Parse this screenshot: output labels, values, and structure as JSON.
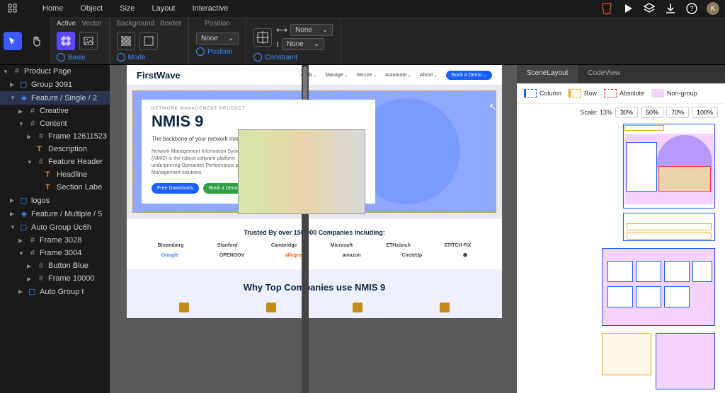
{
  "menu": {
    "items": [
      "Home",
      "Object",
      "Size",
      "Layout",
      "Interactive"
    ],
    "avatar_letter": "K"
  },
  "toolbar": {
    "group1": {
      "head": [
        "Active",
        "Vector"
      ],
      "foot": "Basic"
    },
    "group2": {
      "head": [
        "Background",
        "Border"
      ],
      "foot": "Mode"
    },
    "group3": {
      "head": "Position",
      "value": "None",
      "foot": "Position"
    },
    "group4": {
      "head": "",
      "val1": "None",
      "val2": "None",
      "foot": "Constraint"
    }
  },
  "layers": {
    "root": "Product Page",
    "items": [
      {
        "ind": 1,
        "chev": "▶",
        "ico": "frame",
        "label": "Group 3091"
      },
      {
        "ind": 1,
        "chev": "▼",
        "ico": "hashb",
        "label": "Feature / Single / 2",
        "sel": true
      },
      {
        "ind": 2,
        "chev": "▶",
        "ico": "hash",
        "label": "Creative"
      },
      {
        "ind": 2,
        "chev": "▼",
        "ico": "hash",
        "label": "Content"
      },
      {
        "ind": 3,
        "chev": "▶",
        "ico": "hash",
        "label": "Frame 12611523"
      },
      {
        "ind": 3,
        "chev": "",
        "ico": "text",
        "label": "Description"
      },
      {
        "ind": 3,
        "chev": "▼",
        "ico": "hash",
        "label": "Feature Header"
      },
      {
        "ind": 4,
        "chev": "",
        "ico": "text",
        "label": "Headline"
      },
      {
        "ind": 4,
        "chev": "",
        "ico": "text",
        "label": "Section Labe"
      },
      {
        "ind": 1,
        "chev": "▶",
        "ico": "frame",
        "label": "logos"
      },
      {
        "ind": 1,
        "chev": "▶",
        "ico": "hashb",
        "label": "Feature / Multiple / 5"
      },
      {
        "ind": 1,
        "chev": "▼",
        "ico": "frame",
        "label": "Auto Group Uc6h"
      },
      {
        "ind": 2,
        "chev": "▶",
        "ico": "hash",
        "label": "Frame 3028"
      },
      {
        "ind": 2,
        "chev": "▼",
        "ico": "hash",
        "label": "Frame 3004"
      },
      {
        "ind": 3,
        "chev": "▶",
        "ico": "hash",
        "label": "Button Blue"
      },
      {
        "ind": 3,
        "chev": "▶",
        "ico": "hash",
        "label": "Frame 10000"
      },
      {
        "ind": 2,
        "chev": "▶",
        "ico": "frame",
        "label": "Auto Group t"
      }
    ]
  },
  "page": {
    "logo": "FirstWave",
    "nav": [
      "Audit",
      "Manage",
      "Secure",
      "Automate",
      "About"
    ],
    "cta": "Book a Demo",
    "hero": {
      "tag": "NETWORK MANAGEMENT PRODUCT",
      "title": "NMIS 9",
      "sub": "The backbone of your network management system.",
      "desc": "Network Management Information System (NMIS) is the robust software platform underpinning Opmantek Performance and Management solutions.",
      "btn1": "Free Downloads",
      "btn2": "Book a Demo"
    },
    "trusted": {
      "title": "Trusted By over 150,000 Companies including:",
      "row1": [
        "Bloomberg",
        "Stanford",
        "Cambridge",
        "Microsoft",
        "ETHzürich",
        "STITCH FIX"
      ],
      "row2": [
        "Google",
        "OPENGOV",
        "allegro",
        "amazon",
        "CircleUp",
        "⬢"
      ]
    },
    "why": {
      "title": "Why Top Companies use NMIS 9"
    }
  },
  "right": {
    "tabs": [
      "SceneLayout",
      "CodeView"
    ],
    "legend": [
      "Column",
      "Row",
      "Absolute",
      "Non-group"
    ],
    "scale_label": "Scale: 13%",
    "scales": [
      "30%",
      "50%",
      "70%",
      "100%"
    ]
  }
}
